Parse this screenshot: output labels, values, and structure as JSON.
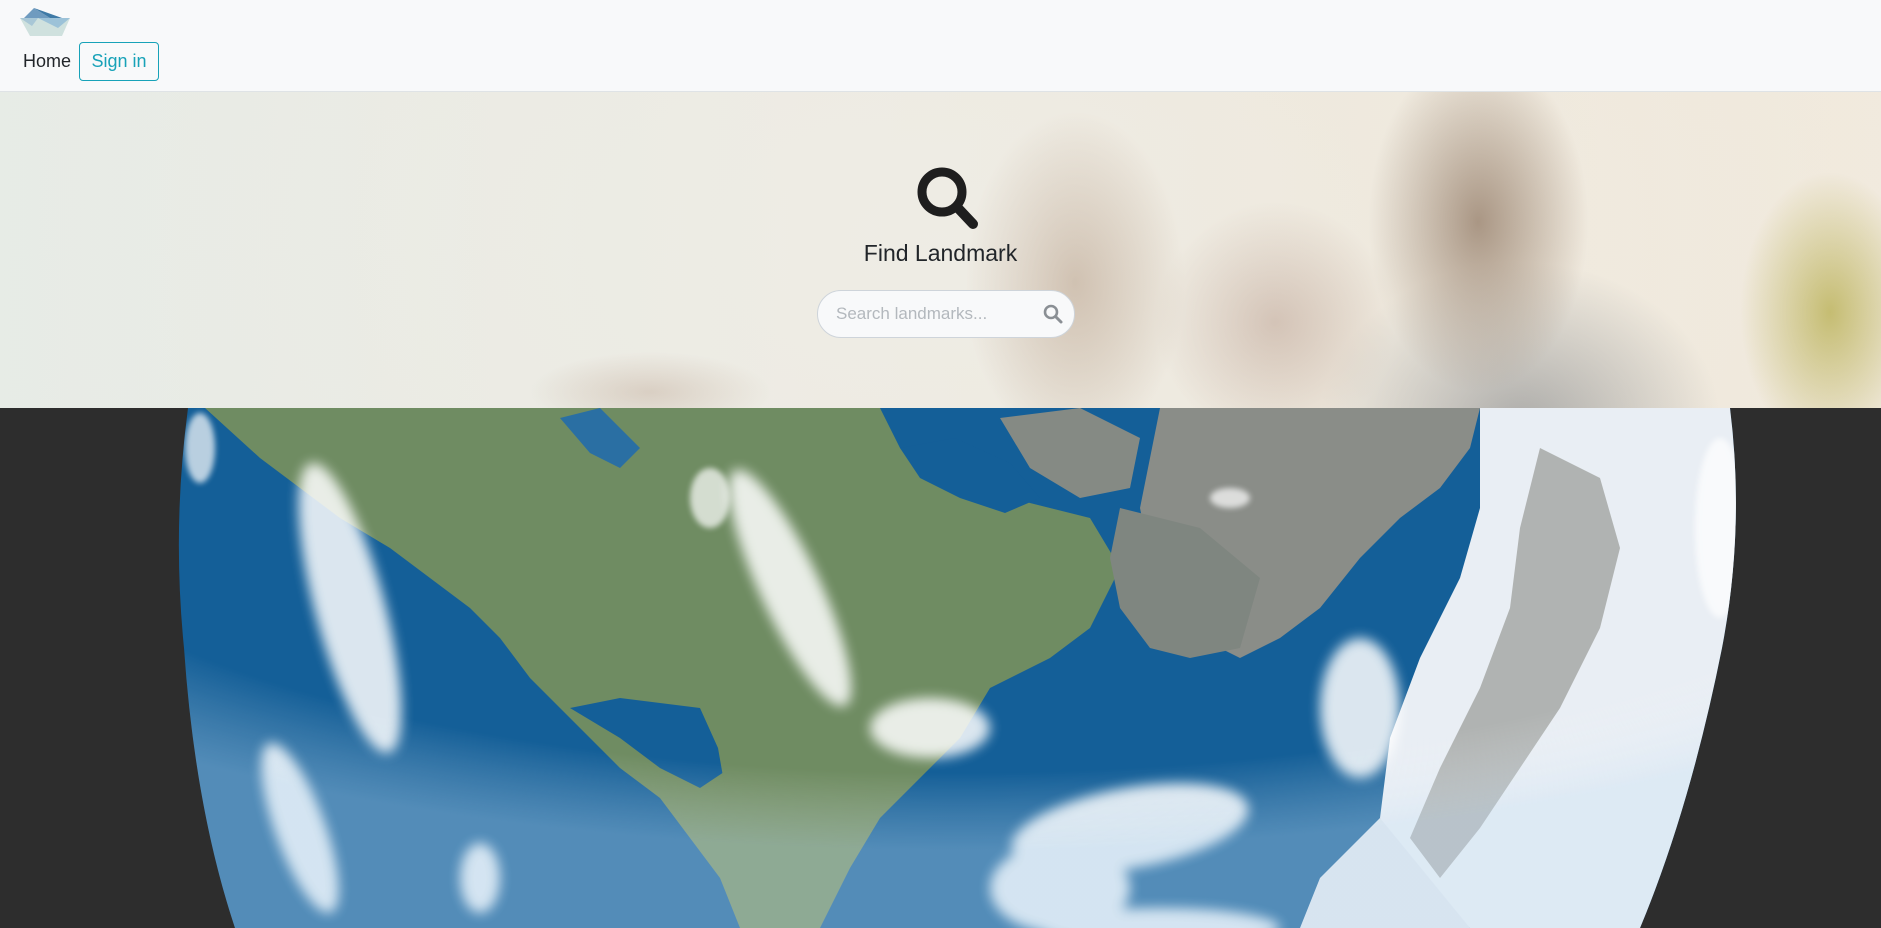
{
  "navbar": {
    "logo_icon": "paper-boat-icon",
    "home_label": "Home",
    "signin_label": "Sign in"
  },
  "hero": {
    "icon": "search-icon",
    "title": "Find Landmark",
    "search": {
      "placeholder": "Search landmarks...",
      "value": "",
      "button_icon": "search-icon"
    }
  },
  "globe": {
    "ocean_color": "#145f98",
    "land_color": "#6d8a60",
    "ice_color": "#e8eef3",
    "background_color": "#2d2d2d"
  }
}
